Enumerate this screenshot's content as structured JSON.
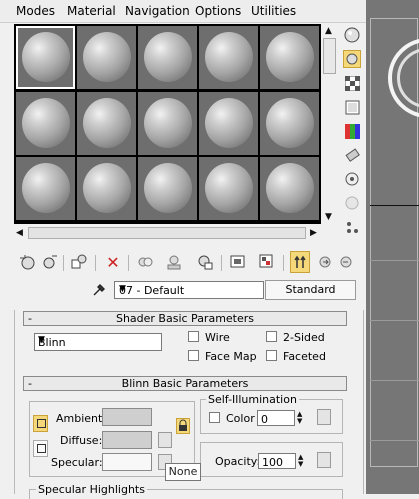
{
  "menubar": {
    "items": [
      {
        "label": "Modes"
      },
      {
        "label": "Material"
      },
      {
        "label": "Navigation"
      },
      {
        "label": "Options"
      },
      {
        "label": "Utilities"
      }
    ]
  },
  "sample_slots": {
    "rows": 3,
    "columns": 5,
    "active_slot": 1
  },
  "side_toolbar": {
    "icons": [
      "sample-type-sphere-icon",
      "backlight-icon",
      "background-checker-icon",
      "sample-uv-tiling-icon",
      "video-color-check-icon",
      "make-preview-icon",
      "options-icon",
      "select-by-material-icon",
      "material-id-navigator-icon"
    ]
  },
  "bottom_toolbar": {
    "icons": [
      "get-material-icon",
      "put-to-scene-icon",
      "assign-to-selection-icon",
      "reset-map-icon",
      "make-unique-icon",
      "put-to-library-icon",
      "material-id-channel-icon",
      "show-shaded-in-viewport-icon",
      "show-end-result-icon",
      "go-to-parent-icon",
      "go-forward-to-sibling-icon"
    ]
  },
  "material": {
    "name": "07 - Default",
    "type_label": "Standard"
  },
  "shader_basic": {
    "title": "Shader Basic Parameters",
    "collapse": "-",
    "shader": "Blinn",
    "wire_label": "Wire",
    "two_sided_label": "2-Sided",
    "face_map_label": "Face Map",
    "faceted_label": "Faceted"
  },
  "blinn_basic": {
    "title": "Blinn Basic Parameters",
    "collapse": "-",
    "ambient_label": "Ambient:",
    "diffuse_label": "Diffuse:",
    "specular_label": "Specular:",
    "self_illumination_title": "Self-Illumination",
    "color_label": "Color",
    "self_illum_value": "0",
    "opacity_label": "Opacity:",
    "opacity_value": "100",
    "specular_highlights_title": "Specular Highlights"
  },
  "tooltip": {
    "text": "None"
  }
}
